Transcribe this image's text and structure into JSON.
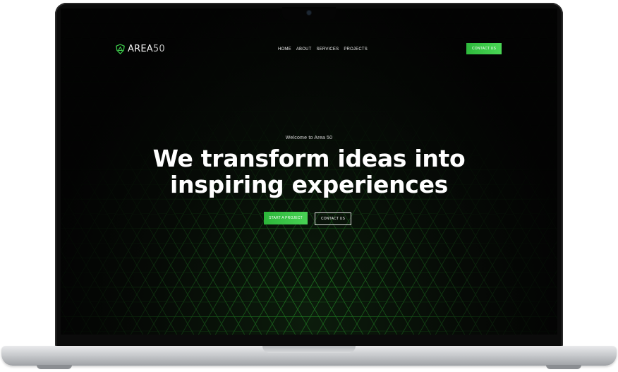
{
  "brand": {
    "logo_text_primary": "AREA",
    "logo_text_accent": "50",
    "logo_icon": "shield-triangle-icon",
    "accent_color": "#3cc84a"
  },
  "nav": {
    "links": [
      "HOME",
      "ABOUT",
      "SERVICES",
      "PROJECTS"
    ],
    "contact_label": "CONTACT US"
  },
  "hero": {
    "eyebrow": "Welcome to Area 50",
    "title_line1": "We transform ideas into",
    "title_line2": "inspiring experiences",
    "primary_button": "START A PROJECT",
    "secondary_button": "CONTACT US"
  }
}
